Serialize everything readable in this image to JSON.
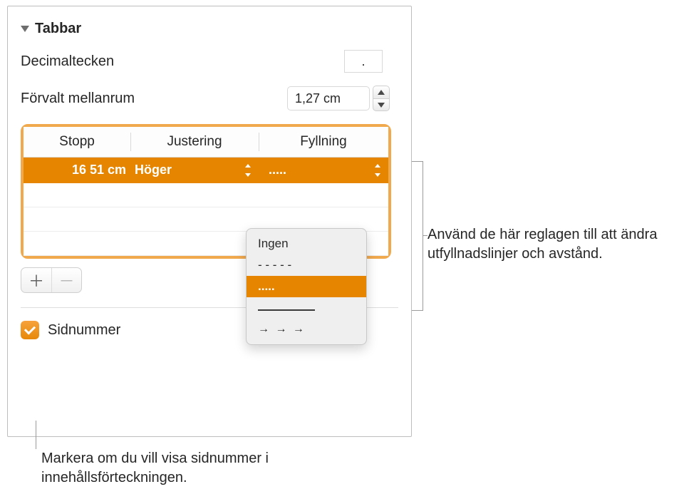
{
  "section": {
    "title": "Tabbar"
  },
  "decimal": {
    "label": "Decimaltecken",
    "value": "."
  },
  "spacing": {
    "label": "Förvalt mellanrum",
    "value": "1,27 cm"
  },
  "table": {
    "headers": {
      "stop": "Stopp",
      "align": "Justering",
      "fill": "Fyllning"
    },
    "row": {
      "stop": "16 51 cm",
      "align": "Höger",
      "fill": "....."
    }
  },
  "fillMenu": {
    "none": "Ingen",
    "dashes": "- - - - -",
    "dots": ".....",
    "arrows": "→ → →"
  },
  "pageNumbers": {
    "label": "Sidnummer",
    "checked": true
  },
  "callouts": {
    "right": "Använd de här reglagen till att ändra utfyllnadslinjer och avstånd.",
    "bottom": "Markera om du vill visa sidnummer i innehållsförteckningen."
  },
  "icons": {
    "plus": "＋",
    "minus": "－"
  }
}
